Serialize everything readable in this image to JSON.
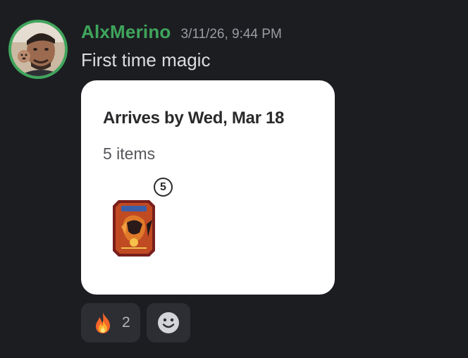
{
  "message": {
    "author": {
      "name": "AlxMerino",
      "name_color": "#3fa55c",
      "avatar": "user-avatar-photo"
    },
    "timestamp": "3/11/26, 9:44 PM",
    "text": "First time magic"
  },
  "embed": {
    "title": "Arrives by Wed, Mar 18",
    "subtitle": "5 items",
    "quantity_badge": "5",
    "product_image": "pokemon-tin-thumbnail"
  },
  "reactions": [
    {
      "emoji": "fire-emoji",
      "count": "2"
    }
  ],
  "add_reaction_icon": "smiley-icon",
  "colors": {
    "background": "#1c1d21",
    "card": "#ffffff",
    "reaction_bg": "#2c2e34"
  }
}
